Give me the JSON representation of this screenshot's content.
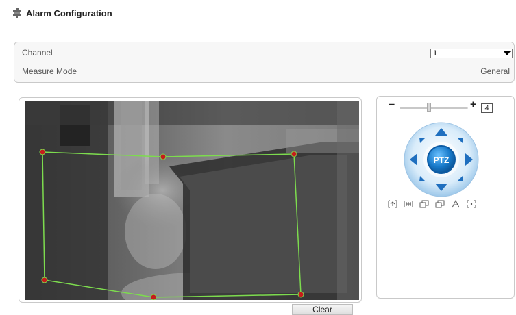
{
  "header": {
    "title": "Alarm Configuration",
    "icon": "config-icon"
  },
  "config": {
    "channel": {
      "label": "Channel",
      "value": "1"
    },
    "measure_mode": {
      "label": "Measure Mode",
      "value": "General"
    }
  },
  "video": {
    "region_points_count": 6
  },
  "clear_button": "Clear",
  "ptz": {
    "zoom_minus": "−",
    "zoom_plus": "+",
    "zoom_level": "4",
    "center_label": "PTZ",
    "tools": [
      "focus-near-icon",
      "focus-far-icon",
      "iris-open-icon",
      "iris-close-icon",
      "auto-focus-icon",
      "lens-reset-icon"
    ]
  }
}
